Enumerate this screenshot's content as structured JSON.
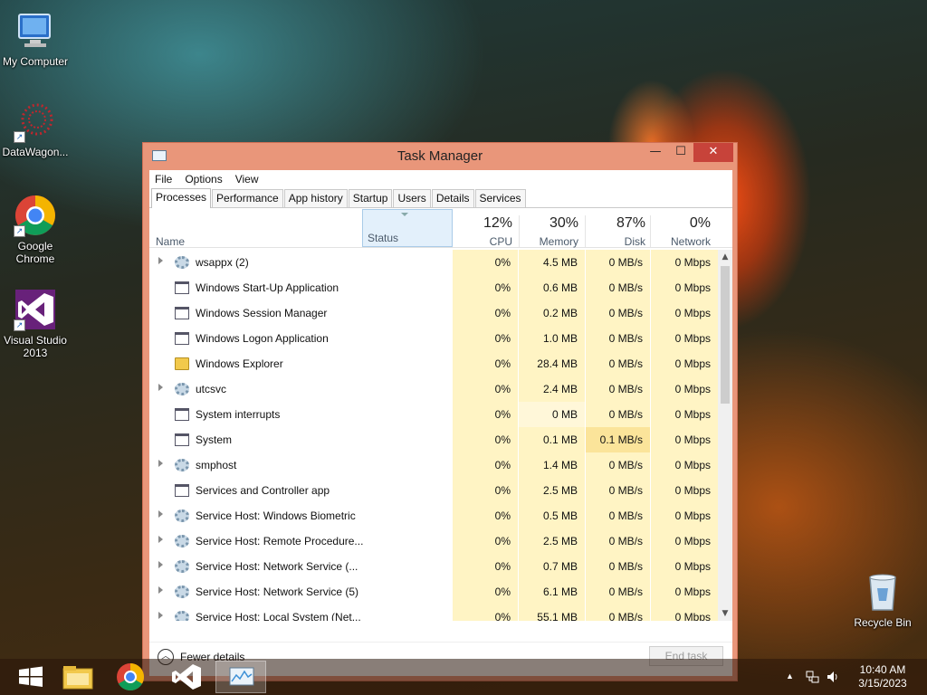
{
  "desktop": {
    "icons": [
      {
        "label": "My Computer",
        "icon": "computer-icon"
      },
      {
        "label": "DataWagon...",
        "icon": "datawagon-icon"
      },
      {
        "label": "Google Chrome",
        "icon": "chrome-icon"
      },
      {
        "label": "Visual Studio 2013",
        "icon": "visual-studio-icon"
      },
      {
        "label": "Recycle Bin",
        "icon": "recycle-bin-icon"
      }
    ]
  },
  "window": {
    "title": "Task Manager",
    "minimize": "—",
    "maximize": "☐",
    "close": "✕"
  },
  "menu": [
    "File",
    "Options",
    "View"
  ],
  "tabs": [
    "Processes",
    "Performance",
    "App history",
    "Startup",
    "Users",
    "Details",
    "Services"
  ],
  "columns": {
    "name": "Name",
    "status": "Status",
    "cpu": {
      "pct": "12%",
      "label": "CPU"
    },
    "memory": {
      "pct": "30%",
      "label": "Memory"
    },
    "disk": {
      "pct": "87%",
      "label": "Disk"
    },
    "network": {
      "pct": "0%",
      "label": "Network"
    }
  },
  "processes": [
    {
      "name": "wsappx (2)",
      "icon": "gear",
      "expand": true,
      "cpu": "0%",
      "memory": "4.5 MB",
      "disk": "0 MB/s",
      "network": "0 Mbps"
    },
    {
      "name": "Windows Start-Up Application",
      "icon": "win",
      "expand": false,
      "cpu": "0%",
      "memory": "0.6 MB",
      "disk": "0 MB/s",
      "network": "0 Mbps"
    },
    {
      "name": "Windows Session Manager",
      "icon": "win",
      "expand": false,
      "cpu": "0%",
      "memory": "0.2 MB",
      "disk": "0 MB/s",
      "network": "0 Mbps"
    },
    {
      "name": "Windows Logon Application",
      "icon": "win",
      "expand": false,
      "cpu": "0%",
      "memory": "1.0 MB",
      "disk": "0 MB/s",
      "network": "0 Mbps"
    },
    {
      "name": "Windows Explorer",
      "icon": "folder",
      "expand": false,
      "cpu": "0%",
      "memory": "28.4 MB",
      "disk": "0 MB/s",
      "network": "0 Mbps"
    },
    {
      "name": "utcsvc",
      "icon": "gear",
      "expand": true,
      "cpu": "0%",
      "memory": "2.4 MB",
      "disk": "0 MB/s",
      "network": "0 Mbps"
    },
    {
      "name": "System interrupts",
      "icon": "win",
      "expand": false,
      "cpu": "0%",
      "memory": "0 MB",
      "disk": "0 MB/s",
      "network": "0 Mbps"
    },
    {
      "name": "System",
      "icon": "win",
      "expand": false,
      "cpu": "0%",
      "memory": "0.1 MB",
      "disk": "0.1 MB/s",
      "network": "0 Mbps"
    },
    {
      "name": "smphost",
      "icon": "gear",
      "expand": true,
      "cpu": "0%",
      "memory": "1.4 MB",
      "disk": "0 MB/s",
      "network": "0 Mbps"
    },
    {
      "name": "Services and Controller app",
      "icon": "win",
      "expand": false,
      "cpu": "0%",
      "memory": "2.5 MB",
      "disk": "0 MB/s",
      "network": "0 Mbps"
    },
    {
      "name": "Service Host: Windows Biometric",
      "icon": "gear",
      "expand": true,
      "cpu": "0%",
      "memory": "0.5 MB",
      "disk": "0 MB/s",
      "network": "0 Mbps"
    },
    {
      "name": "Service Host: Remote Procedure...",
      "icon": "gear",
      "expand": true,
      "cpu": "0%",
      "memory": "2.5 MB",
      "disk": "0 MB/s",
      "network": "0 Mbps"
    },
    {
      "name": "Service Host: Network Service (...",
      "icon": "gear",
      "expand": true,
      "cpu": "0%",
      "memory": "0.7 MB",
      "disk": "0 MB/s",
      "network": "0 Mbps"
    },
    {
      "name": "Service Host: Network Service (5)",
      "icon": "gear",
      "expand": true,
      "cpu": "0%",
      "memory": "6.1 MB",
      "disk": "0 MB/s",
      "network": "0 Mbps"
    },
    {
      "name": "Service Host: Local System (Net...",
      "icon": "gear",
      "expand": true,
      "cpu": "0%",
      "memory": "55.1 MB",
      "disk": "0 MB/s",
      "network": "0 Mbps"
    }
  ],
  "footer": {
    "fewer_details": "Fewer details",
    "end_task": "End task"
  },
  "taskbar": {
    "time": "10:40 AM",
    "date": "3/15/2023"
  }
}
